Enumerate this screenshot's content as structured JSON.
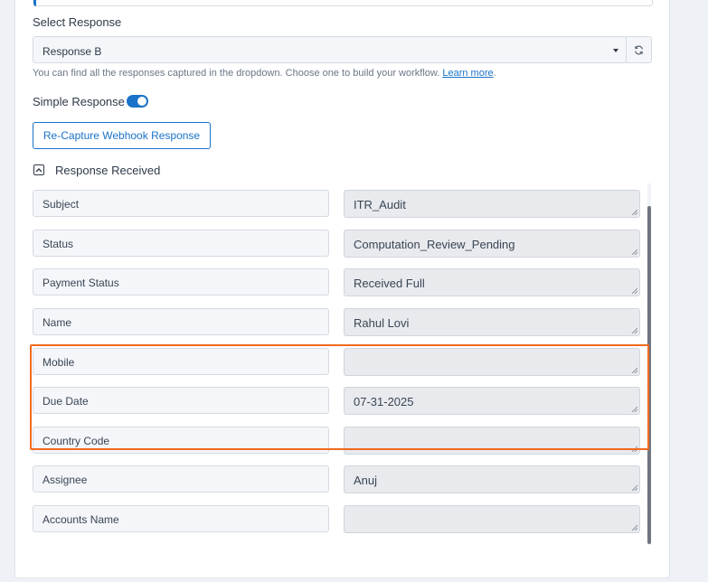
{
  "select_response": {
    "label": "Select Response",
    "selected": "Response B",
    "help_text": "You can find all the responses captured in the dropdown. Choose one to build your workflow.",
    "help_link": "Learn more",
    "help_suffix": "."
  },
  "simple_response": {
    "label": "Simple Response",
    "enabled": true
  },
  "recapture_button": "Re-Capture Webhook Response",
  "response_received": {
    "label": "Response Received",
    "rows": [
      {
        "key": "Subject",
        "value": "ITR_Audit"
      },
      {
        "key": "Status",
        "value": "Computation_Review_Pending"
      },
      {
        "key": "Payment Status",
        "value": "Received Full"
      },
      {
        "key": "Name",
        "value": "Rahul Lovi"
      },
      {
        "key": "Mobile",
        "value": ""
      },
      {
        "key": "Due Date",
        "value": "07-31-2025"
      },
      {
        "key": "Country Code",
        "value": ""
      },
      {
        "key": "Assignee",
        "value": "Anuj"
      },
      {
        "key": "Accounts Name",
        "value": ""
      }
    ]
  },
  "colors": {
    "accent": "#1a73c8",
    "highlight": "#f06a1e"
  },
  "icons": [
    "refresh-icon",
    "chevron-down-icon",
    "collapse-up-icon",
    "resize-grip-icon"
  ]
}
